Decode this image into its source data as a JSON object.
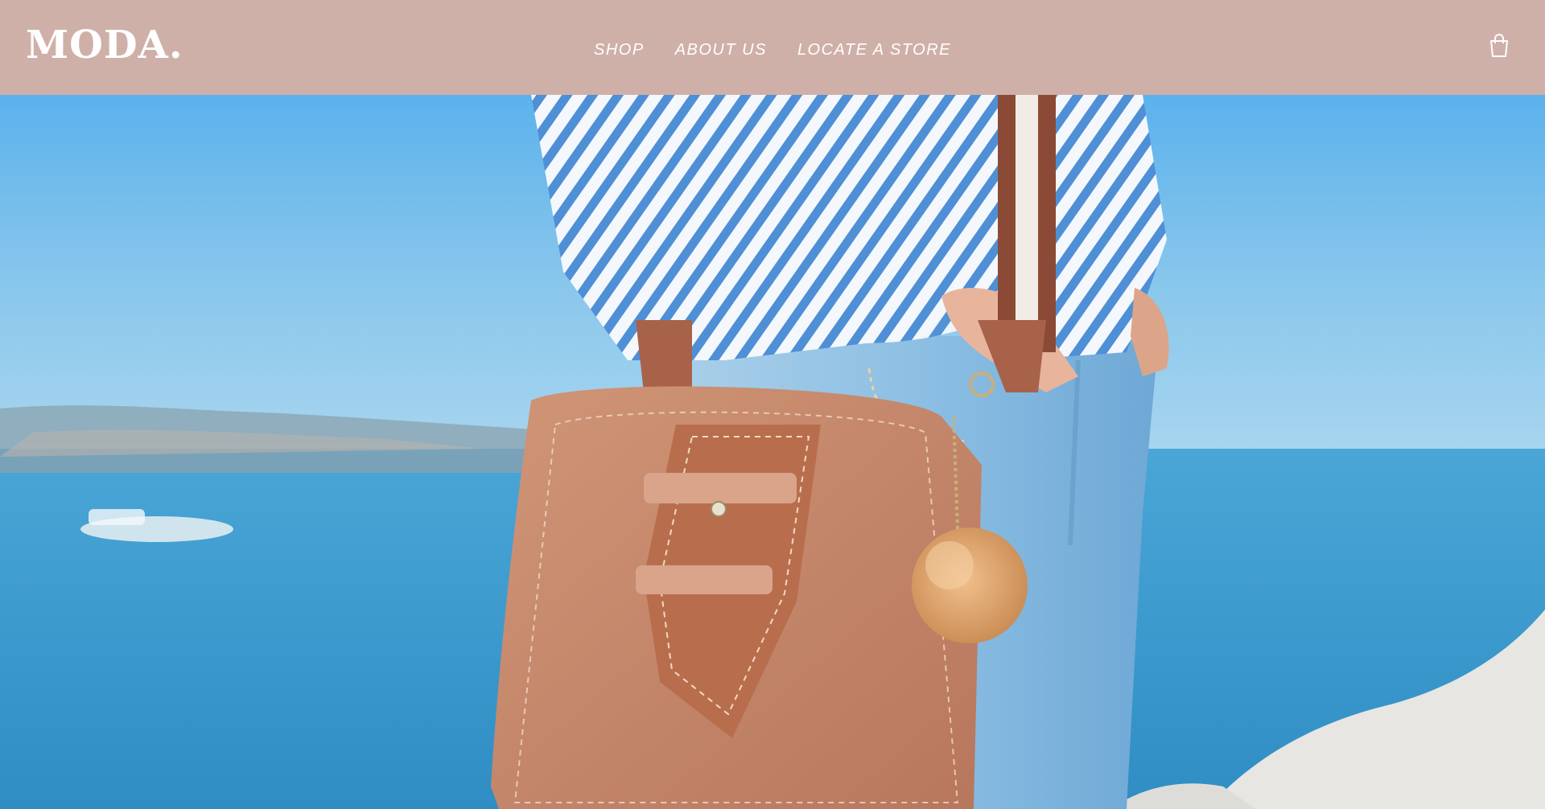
{
  "brand": {
    "logo_text": "MODA."
  },
  "nav": {
    "items": [
      {
        "label": "SHOP"
      },
      {
        "label": "ABOUT US"
      },
      {
        "label": "LOCATE A STORE"
      }
    ]
  },
  "cart": {
    "icon": "shopping-bag-icon"
  },
  "hero": {
    "image": "hero-photo",
    "subject": "brown-leather-handbag-icon"
  },
  "colors": {
    "header_bg": "#cfb0a8",
    "text": "#ffffff",
    "sky": "#7cc0ea",
    "sea": "#3f9fcf",
    "bag": "#c4866a"
  }
}
